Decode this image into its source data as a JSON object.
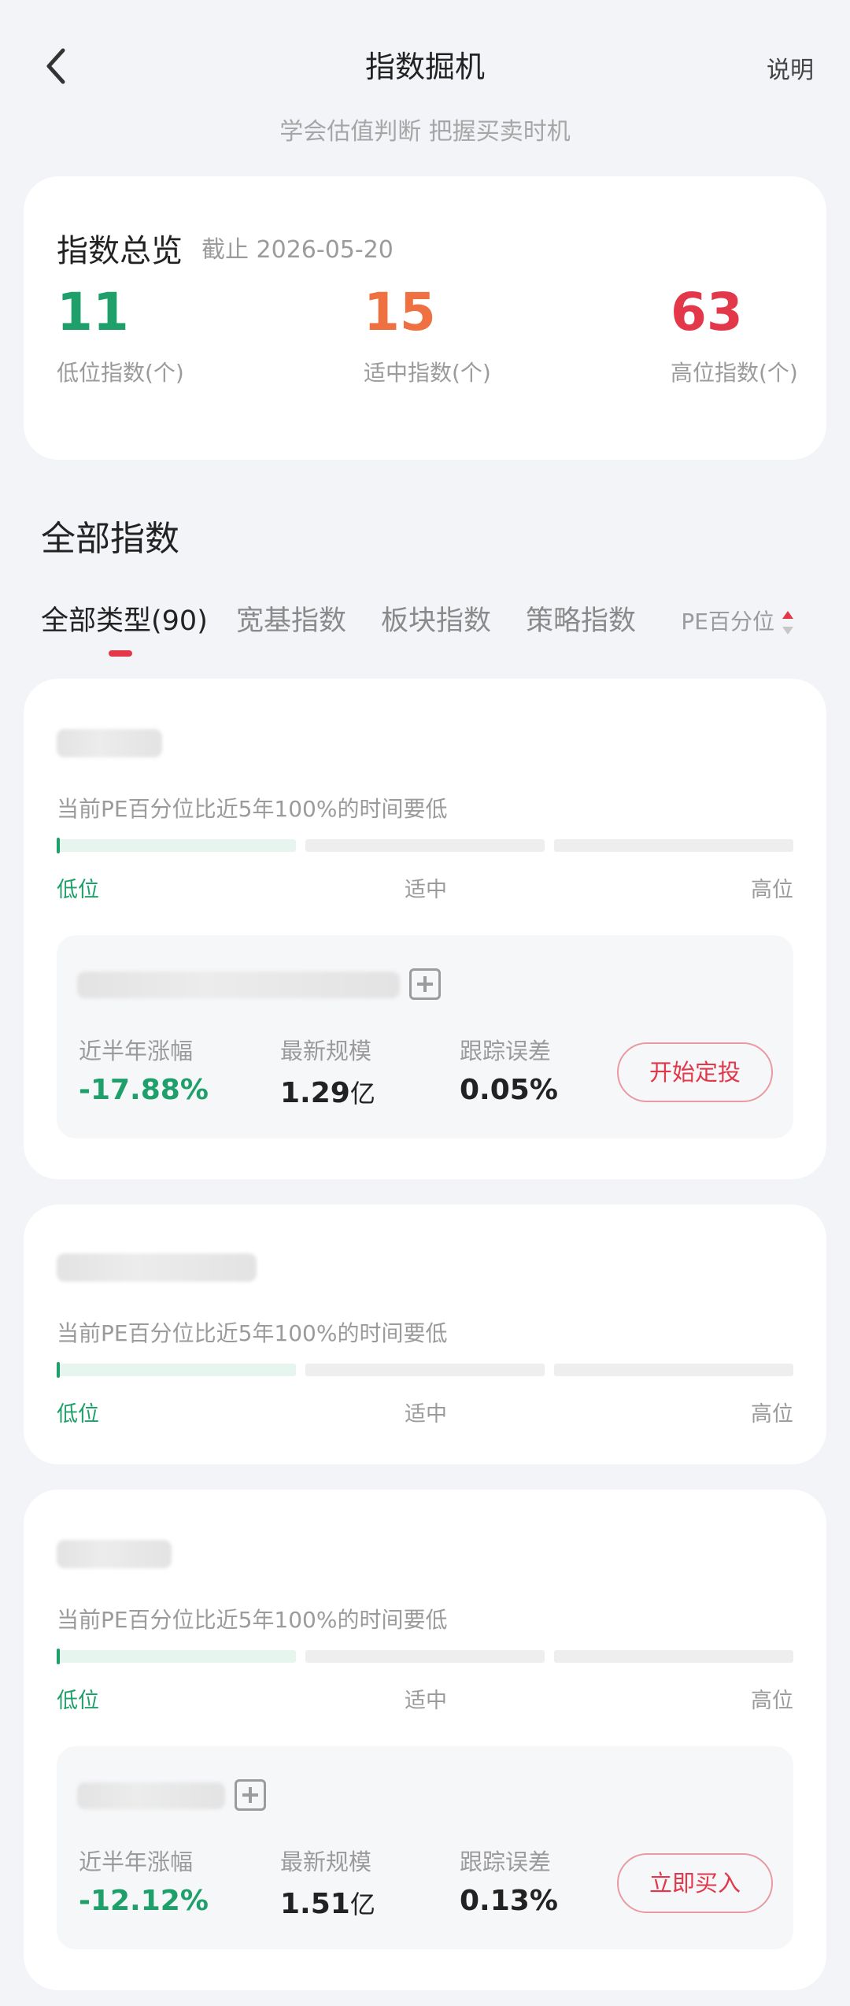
{
  "header": {
    "title": "指数掘机",
    "help_label": "说明",
    "subtitle": "学会估值判断 把握买卖时机"
  },
  "overview": {
    "title": "指数总览",
    "date": "截止 2026-05-20",
    "stats": [
      {
        "value": "11",
        "label": "低位指数(个)",
        "color": "#1fa06b"
      },
      {
        "value": "15",
        "label": "适中指数(个)",
        "color": "#ef7040"
      },
      {
        "value": "63",
        "label": "高位指数(个)",
        "color": "#e2384a"
      }
    ]
  },
  "section": {
    "title": "全部指数",
    "tabs": [
      {
        "label": "全部类型(90)",
        "active": true
      },
      {
        "label": "宽基指数",
        "active": false
      },
      {
        "label": "板块指数",
        "active": false
      },
      {
        "label": "策略指数",
        "active": false
      }
    ],
    "sort_label": "PE百分位"
  },
  "levels": {
    "low": "低位",
    "mid": "适中",
    "high": "高位"
  },
  "index_cards": [
    {
      "desc": "当前PE百分位比近5年100%的时间要低",
      "fund": {
        "labels": [
          "近半年涨幅",
          "最新规模",
          "跟踪误差"
        ],
        "half_year": "-17.88%",
        "scale": "1.29",
        "scale_unit": "亿",
        "tracking_error": "0.05%",
        "button": "开始定投"
      }
    },
    {
      "desc": "当前PE百分位比近5年100%的时间要低"
    },
    {
      "desc": "当前PE百分位比近5年100%的时间要低",
      "fund": {
        "labels": [
          "近半年涨幅",
          "最新规模",
          "跟踪误差"
        ],
        "half_year": "-12.12%",
        "scale": "1.51",
        "scale_unit": "亿",
        "tracking_error": "0.13%",
        "button": "立即买入"
      }
    }
  ]
}
